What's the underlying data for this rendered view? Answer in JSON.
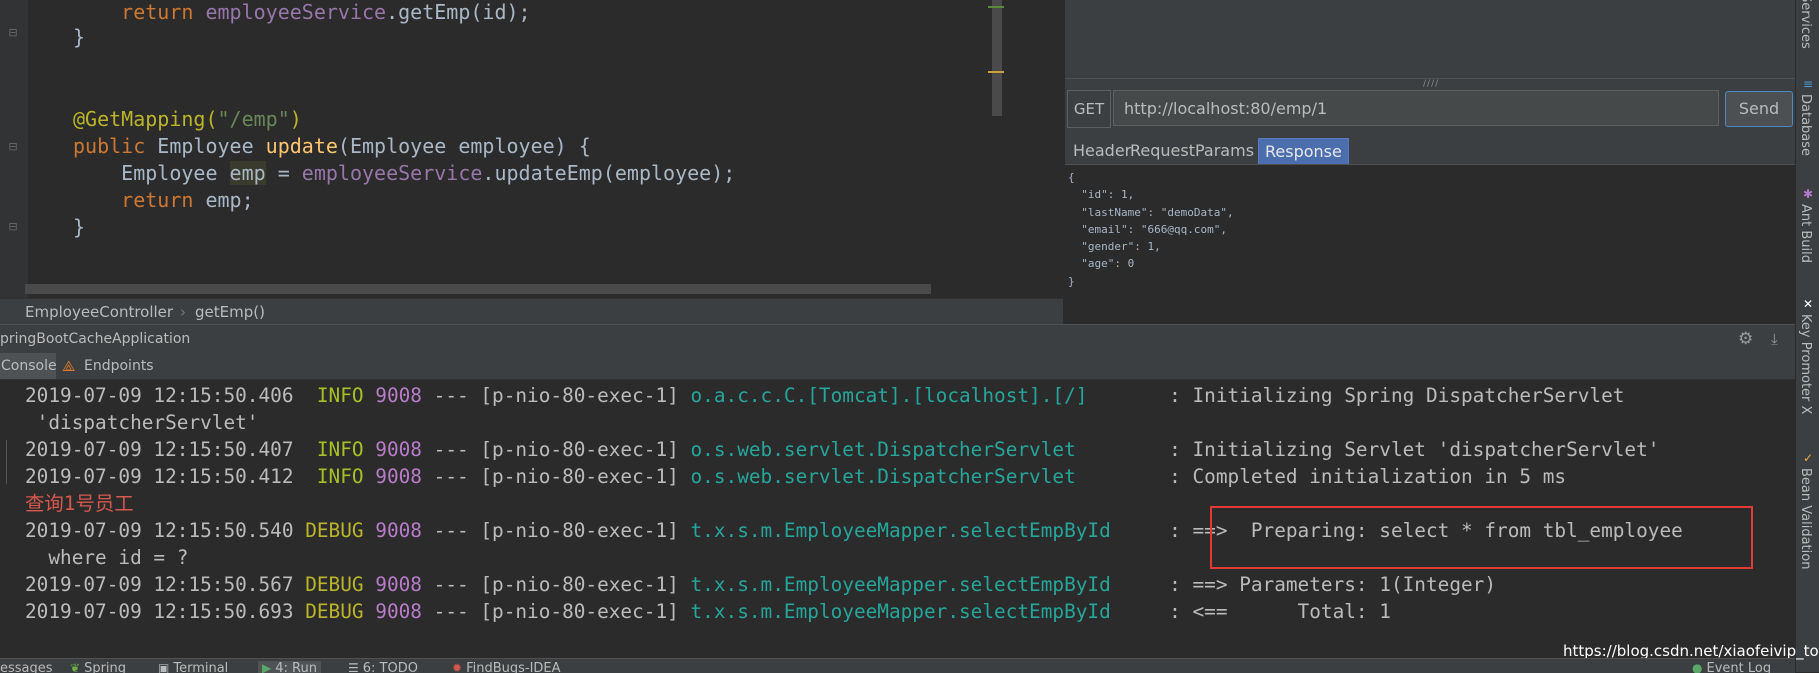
{
  "editor": {
    "lines": {
      "l1_kw": "return ",
      "l1_field": "employeeService",
      "l1_rest": ".getEmp(id);",
      "l2": "}",
      "l3_ann": "@GetMapping(",
      "l3_str": "\"/emp\"",
      "l3_end": ")",
      "l4_kw": "public ",
      "l4_type": "Employee ",
      "l4_fn": "update",
      "l4_rest": "(Employee employee) {",
      "l5_type": "Employee ",
      "l5_var": "emp",
      "l5_eq": " = ",
      "l5_field": "employeeService",
      "l5_rest": ".updateEmp(employee);",
      "l6_kw": "return ",
      "l6_rest": "emp;",
      "l7": "}"
    },
    "breadcrumb": {
      "class": "EmployeeController",
      "separator": "›",
      "method": "getEmp()"
    }
  },
  "rest_client": {
    "method": "GET",
    "url": "http://localhost:80/emp/1",
    "send_label": "Send",
    "tabs": [
      "Header",
      "RequestParams",
      "Response"
    ],
    "active_tab": "Response",
    "drag_handle": "////",
    "response_body": "{\n  \"id\": 1,\n  \"lastName\": \"demoData\",\n  \"email\": \"666@qq.com\",\n  \"gender\": 1,\n  \"age\": 0\n}"
  },
  "right_tools": [
    "Services",
    "Database",
    "Ant Build",
    "Key Promoter X",
    "Bean Validation"
  ],
  "run_panel": {
    "title": "pringBootCacheApplication",
    "tabs": [
      "Console",
      "Endpoints"
    ],
    "console_lines": [
      {
        "ts": "2019-07-09 12:15:50.406",
        "level": " INFO",
        "pid": "9008",
        "sep": " --- ",
        "thread": "[p-nio-80-exec-1]",
        "logger": "o.a.c.c.C.[Tomcat].[localhost].[/]      ",
        "msg": " : Initializing Spring DispatcherServlet"
      },
      {
        "cont": " 'dispatcherServlet'"
      },
      {
        "ts": "2019-07-09 12:15:50.407",
        "level": " INFO",
        "pid": "9008",
        "sep": " --- ",
        "thread": "[p-nio-80-exec-1]",
        "logger": "o.s.web.servlet.DispatcherServlet       ",
        "msg": " : Initializing Servlet 'dispatcherServlet'"
      },
      {
        "ts": "2019-07-09 12:15:50.412",
        "level": " INFO",
        "pid": "9008",
        "sep": " --- ",
        "thread": "[p-nio-80-exec-1]",
        "logger": "o.s.web.servlet.DispatcherServlet       ",
        "msg": " : Completed initialization in 5 ms"
      },
      {
        "cjk": "查询1号员工"
      },
      {
        "ts": "2019-07-09 12:15:50.540",
        "level": "DEBUG",
        "pid": "9008",
        "sep": " --- ",
        "thread": "[p-nio-80-exec-1]",
        "logger": "t.x.s.m.EmployeeMapper.selectEmpById    ",
        "msg": " : ==>  Preparing: select * from tbl_employee"
      },
      {
        "cont": "  where id = ?"
      },
      {
        "ts": "2019-07-09 12:15:50.567",
        "level": "DEBUG",
        "pid": "9008",
        "sep": " --- ",
        "thread": "[p-nio-80-exec-1]",
        "logger": "t.x.s.m.EmployeeMapper.selectEmpById    ",
        "msg": " : ==> Parameters: 1(Integer)"
      },
      {
        "ts": "2019-07-09 12:15:50.693",
        "level": "DEBUG",
        "pid": "9008",
        "sep": " --- ",
        "thread": "[p-nio-80-exec-1]",
        "logger": "t.x.s.m.EmployeeMapper.selectEmpById    ",
        "msg": " : <==      Total: 1"
      }
    ],
    "watermark": "https://blog.csdn.net/xiaofeivip_top"
  },
  "bottom_tabs": [
    "essages",
    "Spring",
    "Terminal",
    "4: Run",
    "6: TODO",
    "FindBugs-IDEA",
    "Event Log"
  ],
  "colors": {
    "accent": "#4b6eaf",
    "highlight_box": "#e53935",
    "background": "#2b2b2b",
    "panel": "#3c3f41"
  }
}
